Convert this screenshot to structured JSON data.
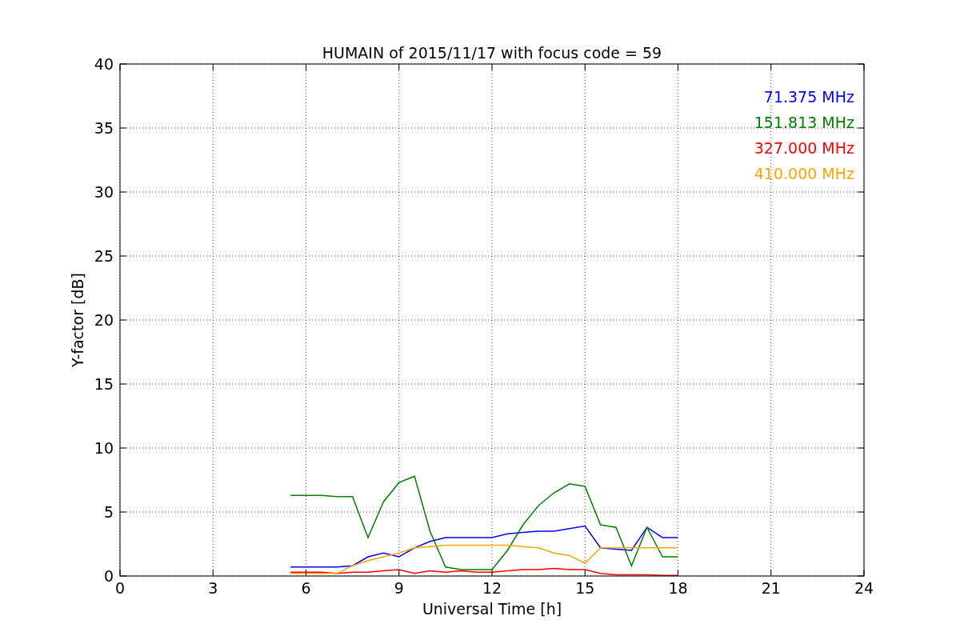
{
  "chart_data": {
    "type": "line",
    "title": "HUMAIN of 2015/11/17 with focus code = 59",
    "xlabel": "Universal Time [h]",
    "ylabel": "Y-factor [dB]",
    "x": [
      5.5,
      6,
      6.5,
      7,
      7.5,
      8,
      8.5,
      9,
      9.5,
      10,
      10.5,
      11,
      11.5,
      12,
      12.5,
      13,
      13.5,
      14,
      14.5,
      15,
      15.5,
      16,
      16.5,
      17,
      17.5,
      18
    ],
    "series": [
      {
        "name": "71.375 MHz",
        "color": "#0000ff",
        "values": [
          0.7,
          0.7,
          0.7,
          0.7,
          0.8,
          1.5,
          1.8,
          1.5,
          2.2,
          2.7,
          3,
          3,
          3,
          3,
          3.3,
          3.4,
          3.5,
          3.5,
          3.7,
          3.9,
          2.2,
          2.1,
          2,
          3.8,
          3,
          3
        ]
      },
      {
        "name": "151.813 MHz",
        "color": "#008000",
        "values": [
          6.3,
          6.3,
          6.3,
          6.2,
          6.2,
          3,
          5.8,
          7.3,
          7.8,
          3.5,
          0.7,
          0.5,
          0.5,
          0.5,
          2,
          4,
          5.5,
          6.5,
          7.2,
          7,
          4,
          3.8,
          0.8,
          3.8,
          1.5,
          1.5
        ]
      },
      {
        "name": "327.000 MHz",
        "color": "#ff0000",
        "values": [
          0.3,
          0.3,
          0.3,
          0.2,
          0.3,
          0.3,
          0.4,
          0.5,
          0.2,
          0.4,
          0.3,
          0.4,
          0.3,
          0.3,
          0.4,
          0.5,
          0.5,
          0.6,
          0.5,
          0.5,
          0.2,
          0.1,
          0.1,
          0.1,
          0.05,
          0.05
        ]
      },
      {
        "name": "410.000 MHz",
        "color": "#ffa500",
        "values": [
          0.2,
          0.2,
          0.2,
          0.2,
          0.8,
          1.2,
          1.5,
          1.8,
          2.2,
          2.3,
          2.4,
          2.4,
          2.4,
          2.4,
          2.4,
          2.3,
          2.2,
          1.8,
          1.6,
          1,
          2.2,
          2.2,
          2.2,
          2.2,
          2.2,
          2.2
        ]
      }
    ],
    "xlim": [
      0,
      24
    ],
    "ylim": [
      0,
      40
    ],
    "xticks": [
      0,
      3,
      6,
      9,
      12,
      15,
      18,
      21,
      24
    ],
    "yticks": [
      0,
      5,
      10,
      15,
      20,
      25,
      30,
      35,
      40
    ],
    "grid": true
  }
}
